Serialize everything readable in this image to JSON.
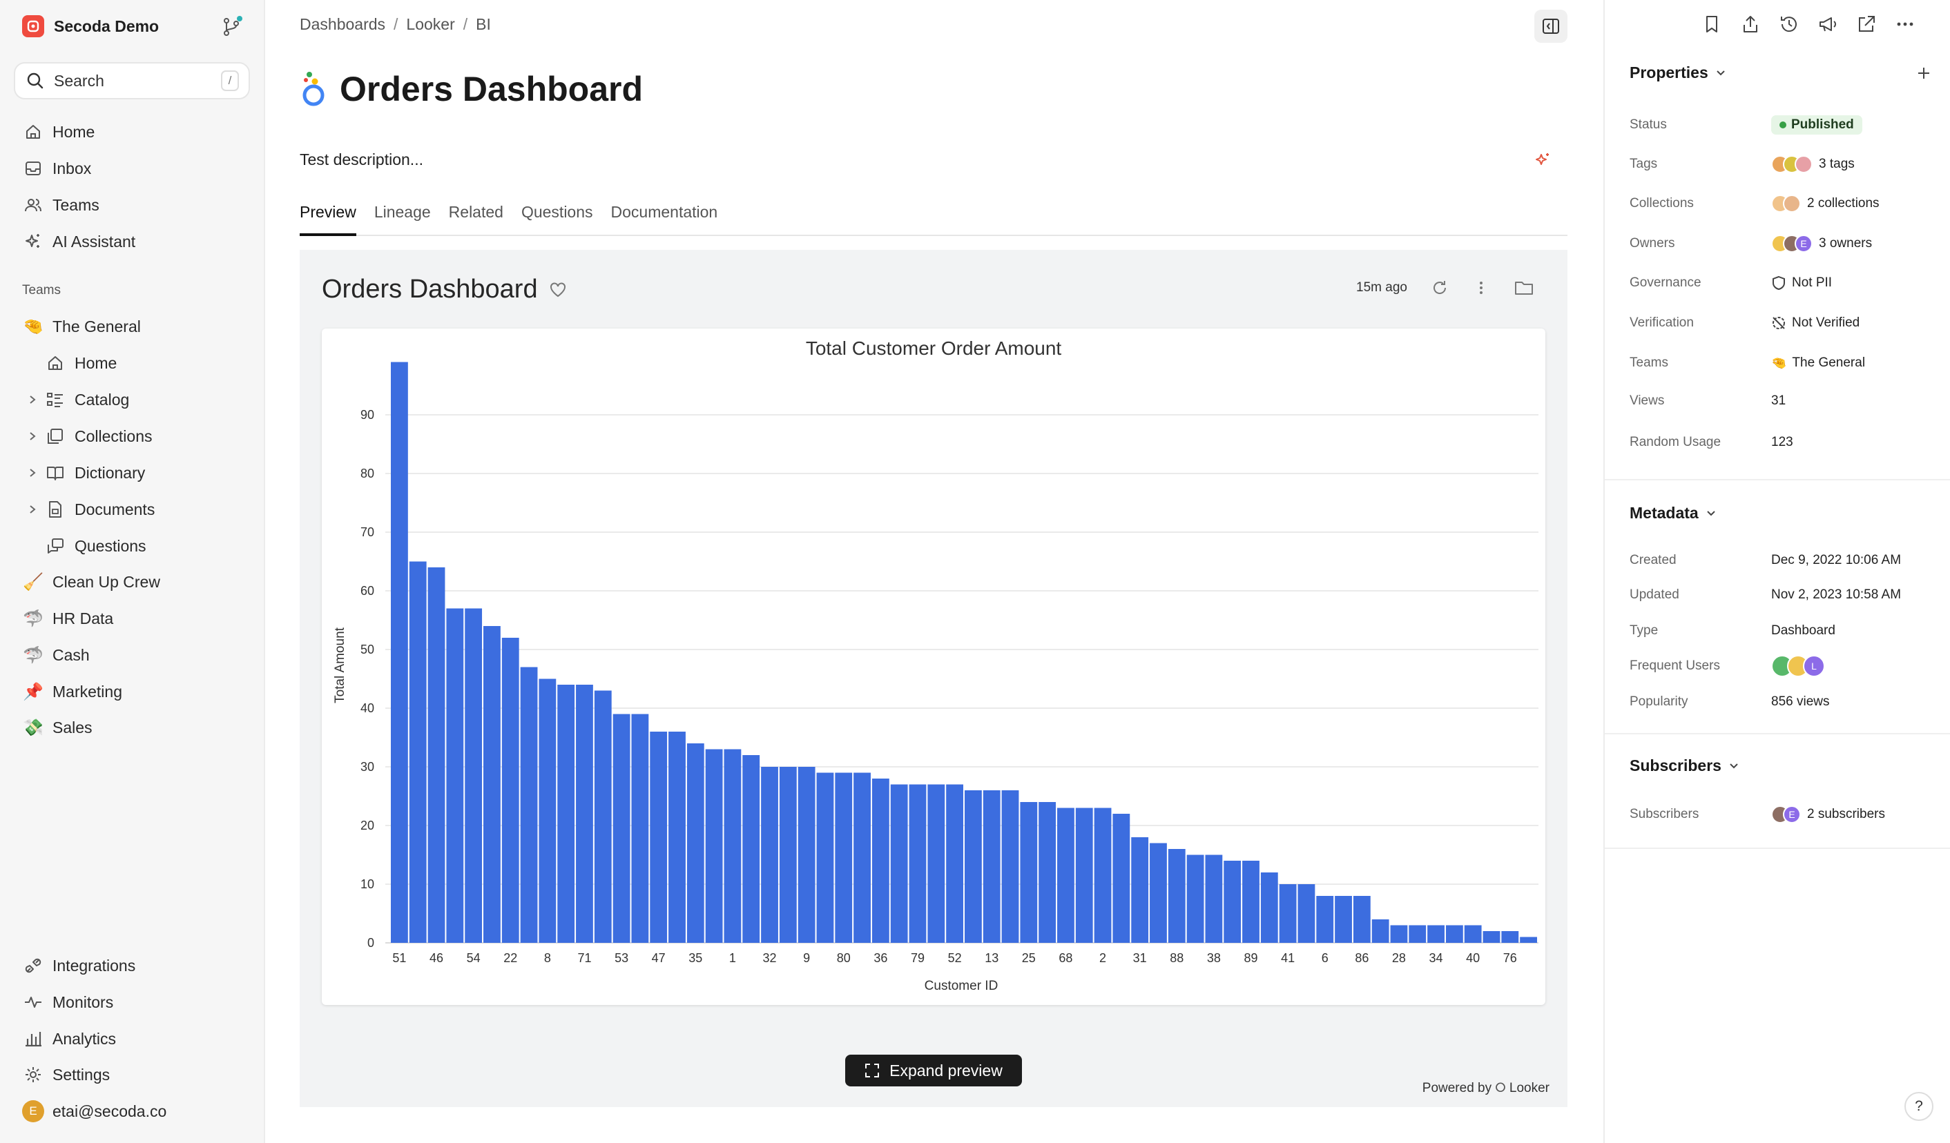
{
  "workspace": {
    "name": "Secoda Demo"
  },
  "search": {
    "label": "Search",
    "shortcut": "/"
  },
  "nav": {
    "home": "Home",
    "inbox": "Inbox",
    "teams": "Teams",
    "ai": "AI Assistant"
  },
  "teams_section": {
    "title": "Teams",
    "general": "The General",
    "general_items": {
      "home": "Home",
      "catalog": "Catalog",
      "collections": "Collections",
      "dictionary": "Dictionary",
      "documents": "Documents",
      "questions": "Questions"
    },
    "others": [
      {
        "label": "Clean Up Crew",
        "emoji": "🧹"
      },
      {
        "label": "HR Data",
        "emoji": "🦈"
      },
      {
        "label": "Cash",
        "emoji": "🦈"
      },
      {
        "label": "Marketing",
        "emoji": "📌"
      },
      {
        "label": "Sales",
        "emoji": "💸"
      }
    ],
    "general_emoji": "🤏"
  },
  "bottom_nav": {
    "integrations": "Integrations",
    "monitors": "Monitors",
    "analytics": "Analytics",
    "settings": "Settings",
    "user": "etai@secoda.co",
    "user_initial": "E"
  },
  "breadcrumbs": [
    "Dashboards",
    "Looker",
    "BI"
  ],
  "breadcrumb_sep": "/",
  "page": {
    "title": "Orders Dashboard",
    "description": "Test description..."
  },
  "tabs": [
    "Preview",
    "Lineage",
    "Related",
    "Questions",
    "Documentation"
  ],
  "preview": {
    "dashboard_title": "Orders Dashboard",
    "updated": "15m ago",
    "expand_label": "Expand preview",
    "powered_by": "Powered by",
    "powered_brand": "Looker"
  },
  "chart_data": {
    "type": "bar",
    "title": "Total Customer Order Amount",
    "xlabel": "Customer ID",
    "ylabel": "Total Amount",
    "ylim": [
      0,
      100
    ],
    "yticks": [
      0,
      10,
      20,
      30,
      40,
      50,
      60,
      70,
      80,
      90
    ],
    "color": "#3c6ddf",
    "x_tick_labels": [
      "51",
      "46",
      "54",
      "22",
      "8",
      "71",
      "53",
      "47",
      "35",
      "1",
      "32",
      "9",
      "80",
      "36",
      "79",
      "52",
      "13",
      "25",
      "68",
      "2",
      "31",
      "88",
      "38",
      "89",
      "41",
      "6",
      "86",
      "28",
      "34",
      "40",
      "76"
    ],
    "values": [
      99,
      65,
      64,
      57,
      57,
      54,
      52,
      47,
      45,
      44,
      44,
      43,
      39,
      39,
      36,
      36,
      34,
      33,
      33,
      32,
      30,
      30,
      30,
      29,
      29,
      29,
      28,
      27,
      27,
      27,
      27,
      26,
      26,
      26,
      24,
      24,
      23,
      23,
      23,
      22,
      18,
      17,
      16,
      15,
      15,
      14,
      14,
      12,
      10,
      10,
      8,
      8,
      8,
      4,
      3,
      3,
      3,
      3,
      3,
      2,
      2,
      1
    ]
  },
  "properties": {
    "title": "Properties",
    "status": {
      "key": "Status",
      "value": "Published"
    },
    "tags": {
      "key": "Tags",
      "value": "3 tags"
    },
    "collections": {
      "key": "Collections",
      "value": "2 collections"
    },
    "owners": {
      "key": "Owners",
      "value": "3 owners"
    },
    "governance": {
      "key": "Governance",
      "value": "Not PII"
    },
    "verification": {
      "key": "Verification",
      "value": "Not Verified"
    },
    "teams": {
      "key": "Teams",
      "value": "The General"
    },
    "views": {
      "key": "Views",
      "value": "31"
    },
    "random_usage": {
      "key": "Random Usage",
      "value": "123"
    }
  },
  "metadata": {
    "title": "Metadata",
    "created": {
      "key": "Created",
      "value": "Dec 9, 2022 10:06 AM"
    },
    "updated": {
      "key": "Updated",
      "value": "Nov 2, 2023 10:58 AM"
    },
    "type": {
      "key": "Type",
      "value": "Dashboard"
    },
    "frequent_users": {
      "key": "Frequent Users",
      "initials": [
        "",
        "",
        "L"
      ]
    },
    "popularity": {
      "key": "Popularity",
      "value": "856 views"
    }
  },
  "subscribers": {
    "title": "Subscribers",
    "row": {
      "key": "Subscribers",
      "value": "2 subscribers"
    }
  },
  "help": "?"
}
